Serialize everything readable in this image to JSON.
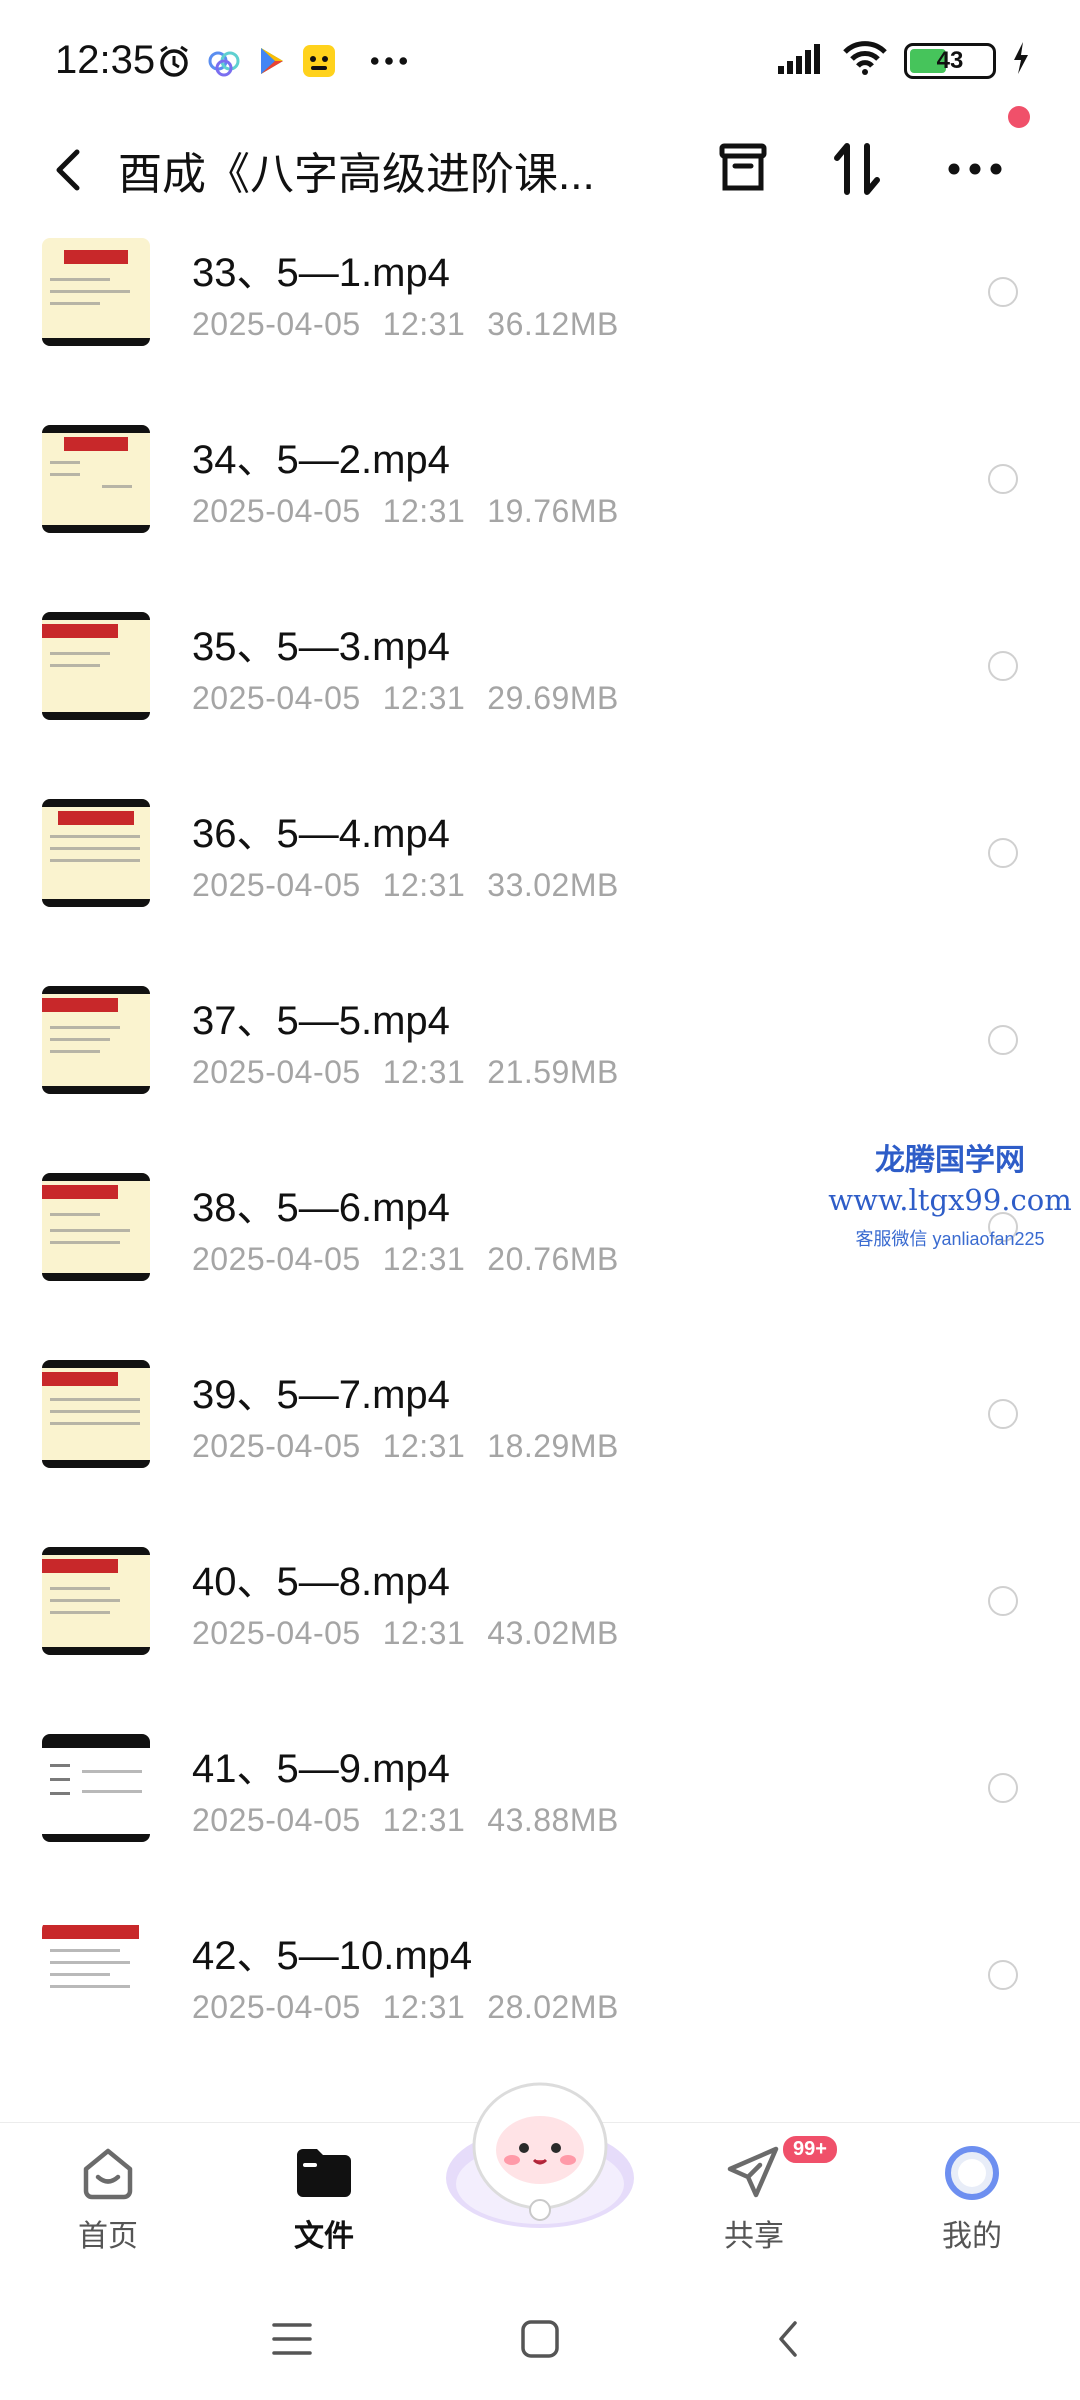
{
  "status": {
    "time": "12:35",
    "battery": "43",
    "notification_icons": [
      "alarm-icon",
      "cloud-app-icon",
      "play-store-icon",
      "yellow-app-icon"
    ]
  },
  "header": {
    "title": "酉成《八字高级进阶课...",
    "icons": [
      "archive-icon",
      "sort-icon",
      "more-icon"
    ]
  },
  "files": [
    {
      "name": "33、5—1.mp4",
      "date": "2025-04-05",
      "time": "12:31",
      "size": "36.12MB"
    },
    {
      "name": "34、5—2.mp4",
      "date": "2025-04-05",
      "time": "12:31",
      "size": "19.76MB"
    },
    {
      "name": "35、5—3.mp4",
      "date": "2025-04-05",
      "time": "12:31",
      "size": "29.69MB"
    },
    {
      "name": "36、5—4.mp4",
      "date": "2025-04-05",
      "time": "12:31",
      "size": "33.02MB"
    },
    {
      "name": "37、5—5.mp4",
      "date": "2025-04-05",
      "time": "12:31",
      "size": "21.59MB"
    },
    {
      "name": "38、5—6.mp4",
      "date": "2025-04-05",
      "time": "12:31",
      "size": "20.76MB"
    },
    {
      "name": "39、5—7.mp4",
      "date": "2025-04-05",
      "time": "12:31",
      "size": "18.29MB"
    },
    {
      "name": "40、5—8.mp4",
      "date": "2025-04-05",
      "time": "12:31",
      "size": "43.02MB"
    },
    {
      "name": "41、5—9.mp4",
      "date": "2025-04-05",
      "time": "12:31",
      "size": "43.88MB"
    },
    {
      "name": "42、5—10.mp4",
      "date": "2025-04-05",
      "time": "12:31",
      "size": "28.02MB"
    }
  ],
  "watermark": {
    "line1": "龙腾国学网",
    "line2": "www.ltgx99.com",
    "line3": "客服微信 yanliaofan225"
  },
  "nav": {
    "home": "首页",
    "files": "文件",
    "share": "共享",
    "share_badge": "99+",
    "me": "我的"
  },
  "colors": {
    "accent_red": "#f0506a",
    "watermark_blue": "#2e5dc8",
    "meta_gray": "#a5a5a5"
  }
}
